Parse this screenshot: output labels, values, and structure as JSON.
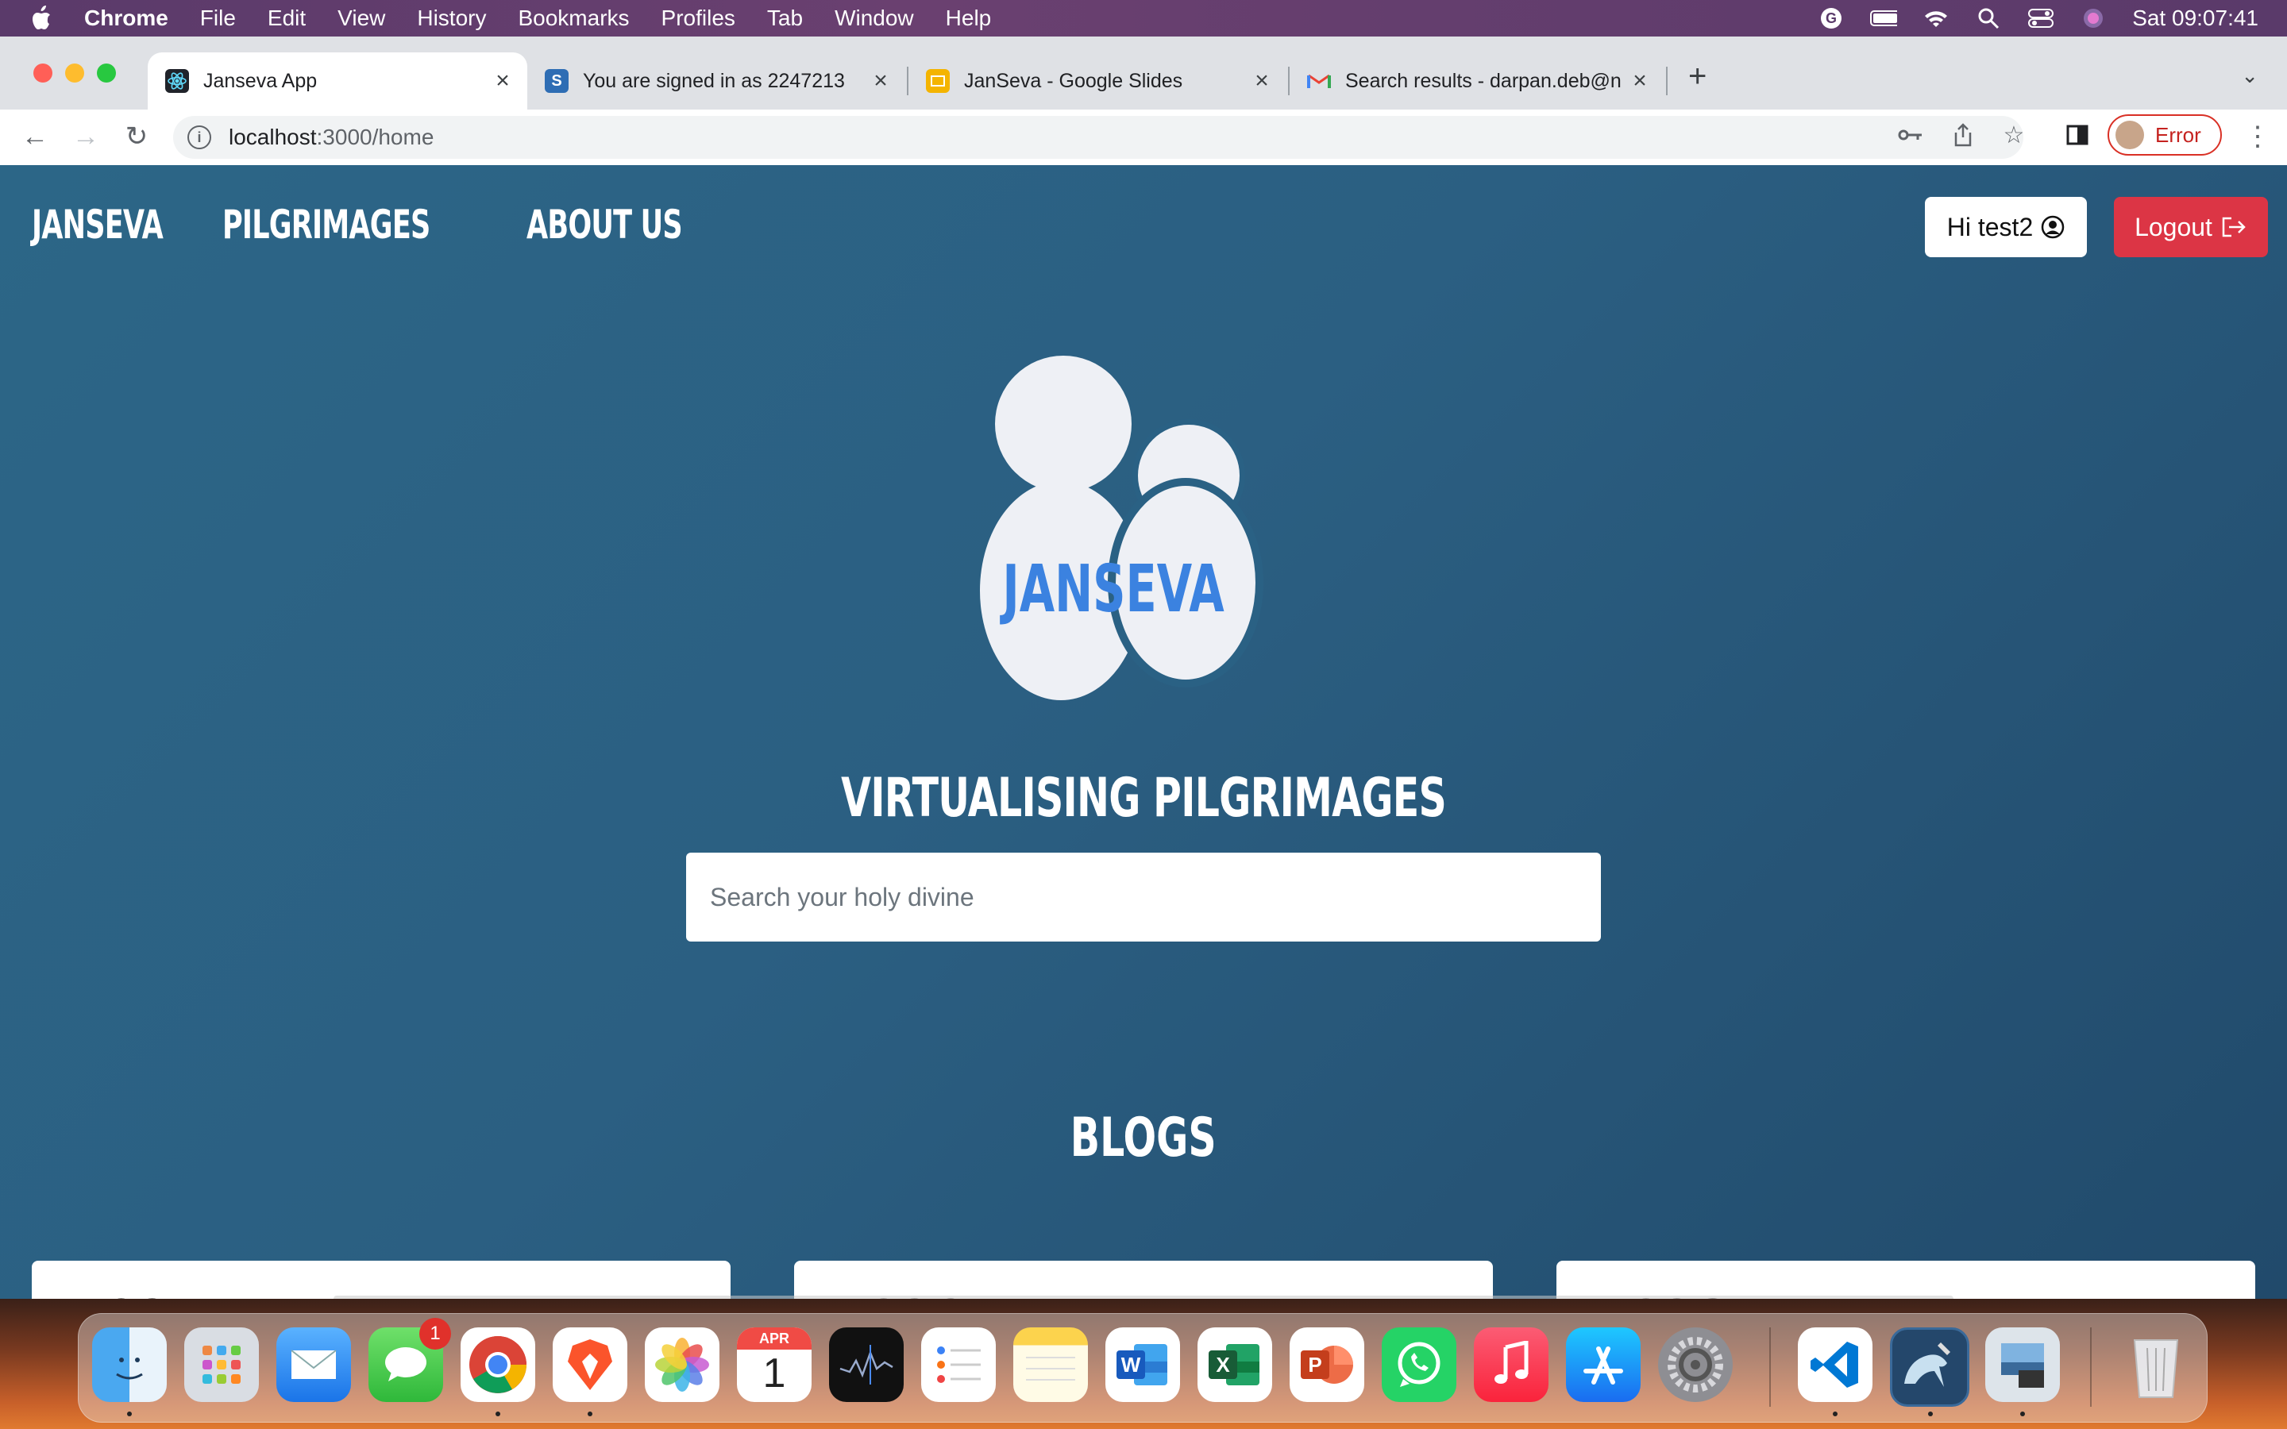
{
  "menubar": {
    "app_name": "Chrome",
    "items": [
      "File",
      "Edit",
      "View",
      "History",
      "Bookmarks",
      "Profiles",
      "Tab",
      "Window",
      "Help"
    ],
    "clock": "Sat 09:07:41"
  },
  "browser": {
    "tabs": [
      {
        "title": "Janseva App",
        "icon": "react-icon",
        "active": true
      },
      {
        "title": "You are signed in as 2247213",
        "icon": "s-icon",
        "active": false
      },
      {
        "title": "JanSeva - Google Slides",
        "icon": "slides-icon",
        "active": false
      },
      {
        "title": "Search results - darpan.deb@n",
        "icon": "gmail-icon",
        "active": false
      }
    ],
    "new_tab": "+",
    "url_host": "localhost",
    "url_path": ":3000/home",
    "profile_label": "Error"
  },
  "page": {
    "nav": {
      "brand": "JANSEVA",
      "links": [
        "PILGRIMAGES",
        "ABOUT US"
      ]
    },
    "greeting": "Hi test2",
    "logout": "Logout",
    "logo_text": "JANSEVA",
    "tagline": "VIRTUALISING PILGRIMAGES",
    "search_placeholder": "Search your holy divine",
    "blogs_heading": "BLOGS",
    "blog_cards": [
      "BLOG 1",
      "BLOG 2",
      "BLOG 3"
    ]
  },
  "dock": {
    "apps": [
      "Finder",
      "Launchpad",
      "Mail",
      "Messages",
      "Chrome",
      "Brave",
      "Photos",
      "Calendar",
      "Stocks",
      "Reminders",
      "Notes",
      "Word",
      "Excel",
      "PowerPoint",
      "WhatsApp",
      "Music",
      "App Store",
      "System Settings",
      "VS Code",
      "MySQL Workbench",
      "Preview",
      "Trash"
    ],
    "messages_badge": "1",
    "calendar_month": "APR",
    "calendar_day": "1"
  },
  "colors": {
    "page_bg": "#2b5f82",
    "logout_red": "#dc3545",
    "logo_blue": "#3b82e0"
  }
}
